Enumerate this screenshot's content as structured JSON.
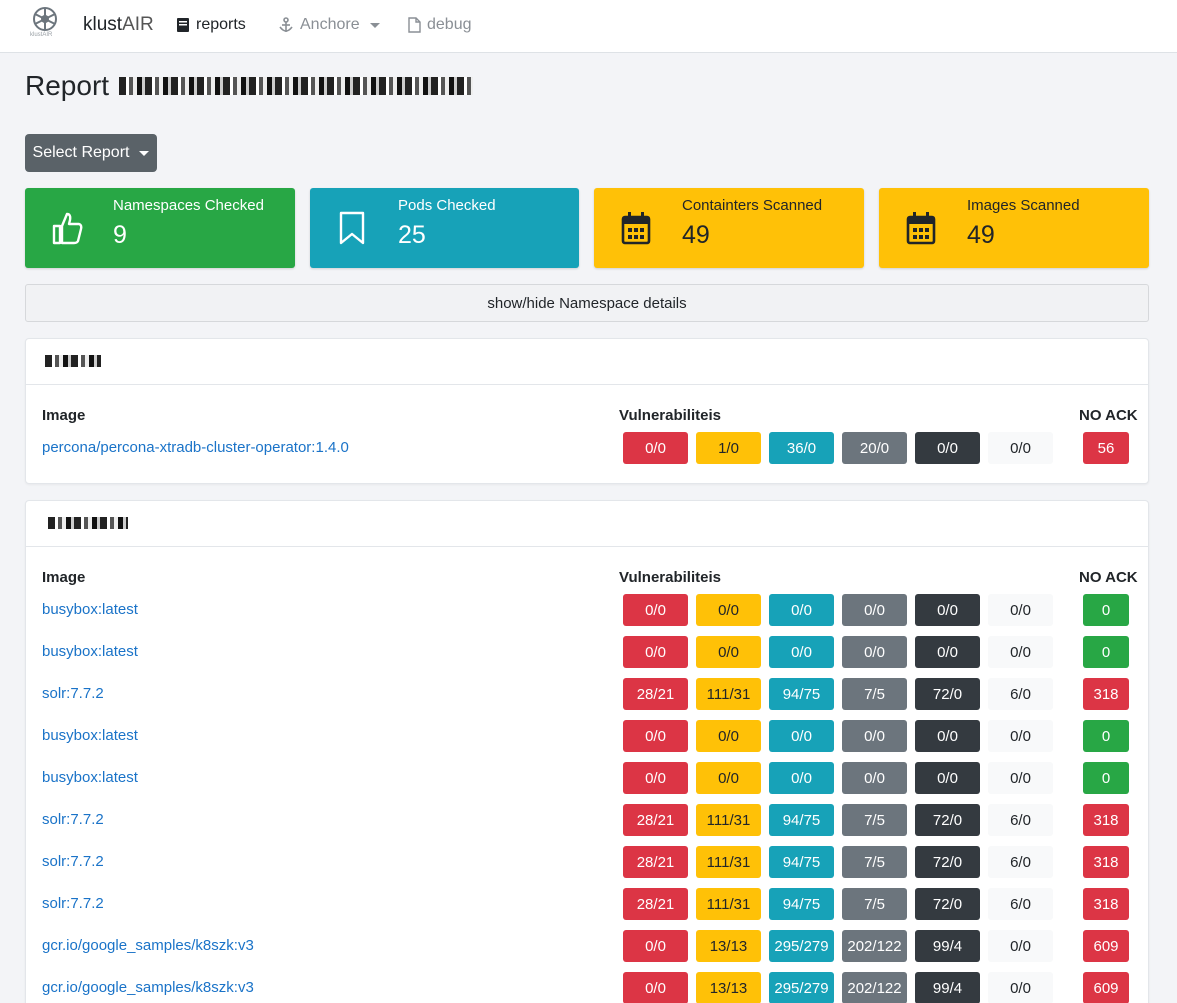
{
  "nav": {
    "logo_sub": "klustAIR",
    "brand_a": "klust",
    "brand_b": "AIR",
    "reports": "reports",
    "anchore": "Anchore",
    "debug": "debug"
  },
  "page": {
    "title": "Report",
    "select_report": "Select Report",
    "toggle_details": "show/hide Namespace details"
  },
  "stats": [
    {
      "label": "Namespaces Checked",
      "value": "9",
      "icon": "thumbs-up-icon"
    },
    {
      "label": "Pods Checked",
      "value": "25",
      "icon": "bookmark-icon"
    },
    {
      "label": "Containters Scanned",
      "value": "49",
      "icon": "calendar-icon"
    },
    {
      "label": "Images Scanned",
      "value": "49",
      "icon": "calendar-icon"
    }
  ],
  "table_headers": {
    "image": "Image",
    "vulns": "Vulnerabiliteis",
    "noack": "NO ACK"
  },
  "namespaces": [
    {
      "rows": [
        {
          "image": "percona/percona-xtradb-cluster-operator:1.4.0",
          "v": [
            "0/0",
            "1/0",
            "36/0",
            "20/0",
            "0/0",
            "0/0"
          ],
          "ack": "56"
        }
      ]
    },
    {
      "rows": [
        {
          "image": "busybox:latest",
          "v": [
            "0/0",
            "0/0",
            "0/0",
            "0/0",
            "0/0",
            "0/0"
          ],
          "ack": "0"
        },
        {
          "image": "busybox:latest",
          "v": [
            "0/0",
            "0/0",
            "0/0",
            "0/0",
            "0/0",
            "0/0"
          ],
          "ack": "0"
        },
        {
          "image": "solr:7.7.2",
          "v": [
            "28/21",
            "111/31",
            "94/75",
            "7/5",
            "72/0",
            "6/0"
          ],
          "ack": "318"
        },
        {
          "image": "busybox:latest",
          "v": [
            "0/0",
            "0/0",
            "0/0",
            "0/0",
            "0/0",
            "0/0"
          ],
          "ack": "0"
        },
        {
          "image": "busybox:latest",
          "v": [
            "0/0",
            "0/0",
            "0/0",
            "0/0",
            "0/0",
            "0/0"
          ],
          "ack": "0"
        },
        {
          "image": "solr:7.7.2",
          "v": [
            "28/21",
            "111/31",
            "94/75",
            "7/5",
            "72/0",
            "6/0"
          ],
          "ack": "318"
        },
        {
          "image": "solr:7.7.2",
          "v": [
            "28/21",
            "111/31",
            "94/75",
            "7/5",
            "72/0",
            "6/0"
          ],
          "ack": "318"
        },
        {
          "image": "solr:7.7.2",
          "v": [
            "28/21",
            "111/31",
            "94/75",
            "7/5",
            "72/0",
            "6/0"
          ],
          "ack": "318"
        },
        {
          "image": "gcr.io/google_samples/k8szk:v3",
          "v": [
            "0/0",
            "13/13",
            "295/279",
            "202/122",
            "99/4",
            "0/0"
          ],
          "ack": "609"
        },
        {
          "image": "gcr.io/google_samples/k8szk:v3",
          "v": [
            "0/0",
            "13/13",
            "295/279",
            "202/122",
            "99/4",
            "0/0"
          ],
          "ack": "609"
        }
      ]
    }
  ]
}
